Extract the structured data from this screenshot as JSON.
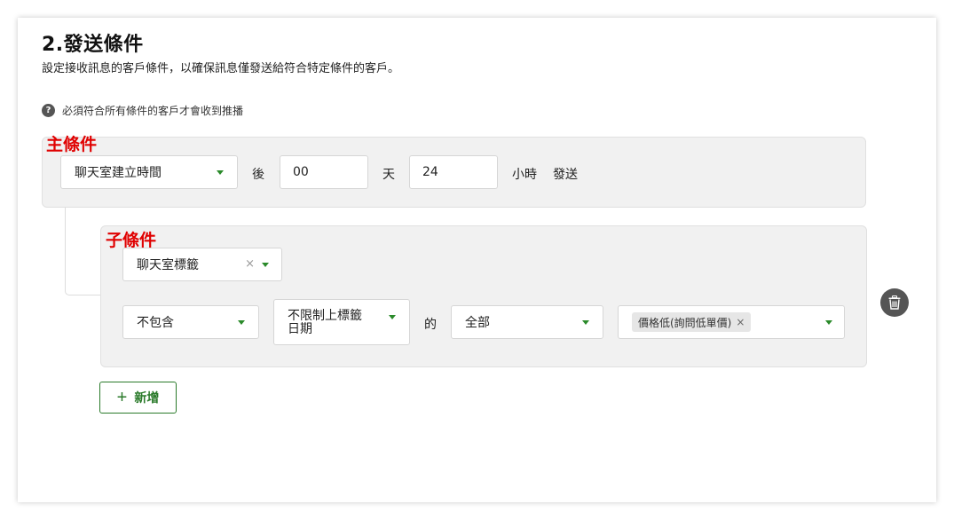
{
  "section": {
    "title": "2.發送條件",
    "description": "設定接收訊息的客戶條件，以確保訊息僅發送給符合特定條件的客戶。",
    "hint": "必須符合所有條件的客戶才會收到推播",
    "help_icon_glyph": "?"
  },
  "main_condition": {
    "label": "主條件",
    "trigger_select": "聊天室建立時間",
    "after_text": "後",
    "days_value": "00",
    "days_unit": "天",
    "hours_value": "24",
    "hours_unit": "小時",
    "send_text": "發送"
  },
  "sub_condition": {
    "label": "子條件",
    "type_select": "聊天室標籤",
    "clear_glyph": "×",
    "operator_select": "不包含",
    "date_select_line1": "不限制上標籤",
    "date_select_line2": "日期",
    "of_text": "的",
    "scope_select": "全部",
    "tags": [
      {
        "label": "價格低(詢問低單價)",
        "remove_glyph": "×"
      }
    ]
  },
  "actions": {
    "add_label": "新增",
    "add_icon": "+"
  },
  "colors": {
    "label_red": "#e00000",
    "accent_green": "#2a7a2a",
    "panel_bg": "#f1f1f1"
  }
}
